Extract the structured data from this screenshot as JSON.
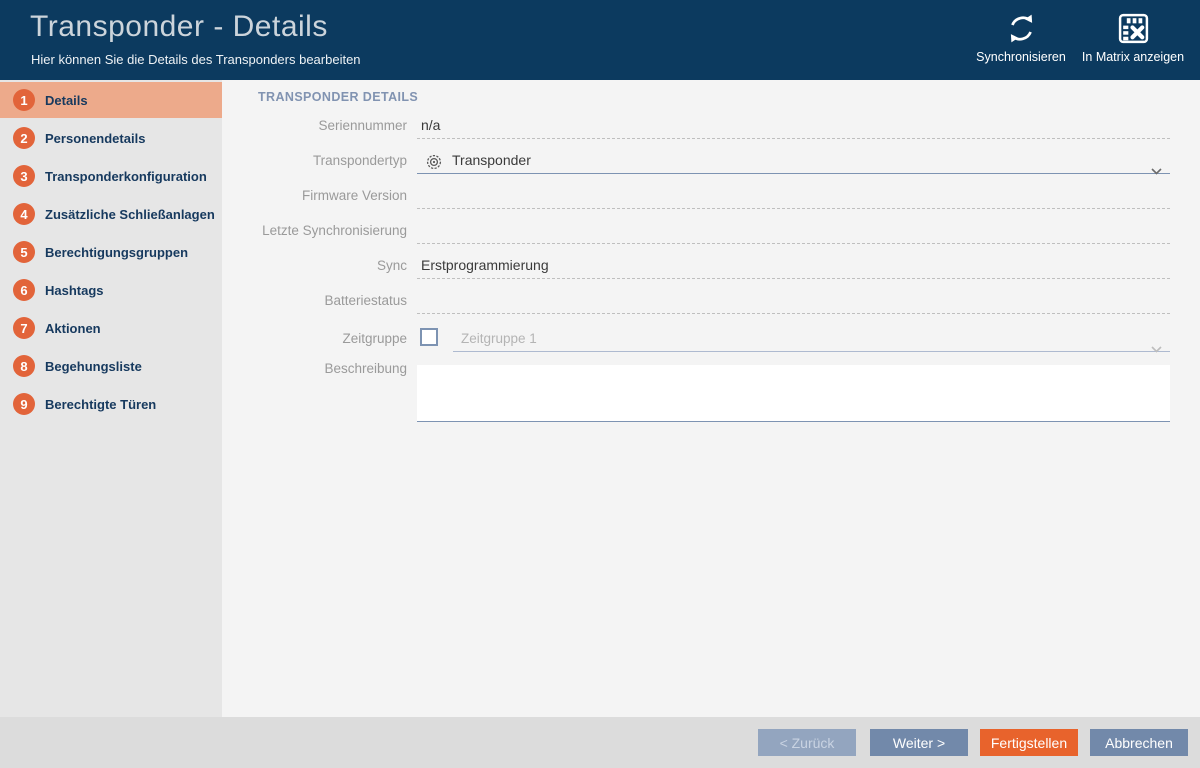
{
  "window": {
    "title": "Transponder - Details",
    "subtitle": "Hier können Sie die Details des Transponders bearbeiten"
  },
  "header_actions": {
    "synchronize": "Synchronisieren",
    "show_in_matrix": "In Matrix anzeigen"
  },
  "sidebar": {
    "active_index": 0,
    "items": [
      {
        "number": "1",
        "label": "Details"
      },
      {
        "number": "2",
        "label": "Personendetails"
      },
      {
        "number": "3",
        "label": "Transponderkonfiguration"
      },
      {
        "number": "4",
        "label": "Zusätzliche Schließanlagen"
      },
      {
        "number": "5",
        "label": "Berechtigungsgruppen"
      },
      {
        "number": "6",
        "label": "Hashtags"
      },
      {
        "number": "7",
        "label": "Aktionen"
      },
      {
        "number": "8",
        "label": "Begehungsliste"
      },
      {
        "number": "9",
        "label": "Berechtigte Türen"
      }
    ]
  },
  "form": {
    "section_title": "TRANSPONDER DETAILS",
    "seriennummer": {
      "label": "Seriennummer",
      "value": "n/a"
    },
    "transpondertyp": {
      "label": "Transpondertyp",
      "value": "Transponder"
    },
    "firmware_version": {
      "label": "Firmware Version",
      "value": ""
    },
    "letzte_synchronisierung": {
      "label": "Letzte Synchronisierung",
      "value": ""
    },
    "sync": {
      "label": "Sync",
      "value": "Erstprogrammierung"
    },
    "batteriestatus": {
      "label": "Batteriestatus",
      "value": ""
    },
    "zeitgruppe": {
      "label": "Zeitgruppe",
      "value": "Zeitgruppe 1",
      "checked": false,
      "disabled": true
    },
    "beschreibung": {
      "label": "Beschreibung",
      "value": ""
    }
  },
  "footer": {
    "back": "< Zurück",
    "next": "Weiter >",
    "finish": "Fertigstellen",
    "cancel": "Abbrechen"
  },
  "colors": {
    "header_bg": "#0c3a5f",
    "accent_orange": "#e8632c",
    "step_circle_orange": "#e2643a",
    "active_step_bg": "#edaa8b",
    "button_blue": "#7289aa",
    "section_title_blue": "#8193b1",
    "sidebar_bg": "#e6e6e6",
    "footer_bg": "#dcdcdc",
    "content_bg": "#f4f4f4"
  }
}
